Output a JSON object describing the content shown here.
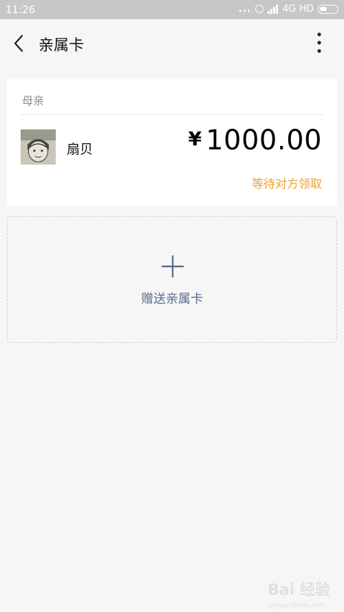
{
  "status_bar": {
    "time": "11:26",
    "dots": "...",
    "network": "4G HD"
  },
  "header": {
    "title": "亲属卡",
    "back_icon": "chevron-left-icon",
    "more_icon": "more-vertical-icon"
  },
  "card": {
    "relation": "母亲",
    "recipient_name": "扇贝",
    "currency_symbol": "¥",
    "amount": "1000.00",
    "status": "等待对方领取",
    "status_color": "#f0a030"
  },
  "add_card": {
    "label": "赠送亲属卡",
    "icon": "plus-icon",
    "accent": "#5b6c8f"
  },
  "watermark": {
    "text": "Bai 经验",
    "sub": "jingyan.baidu.com"
  }
}
